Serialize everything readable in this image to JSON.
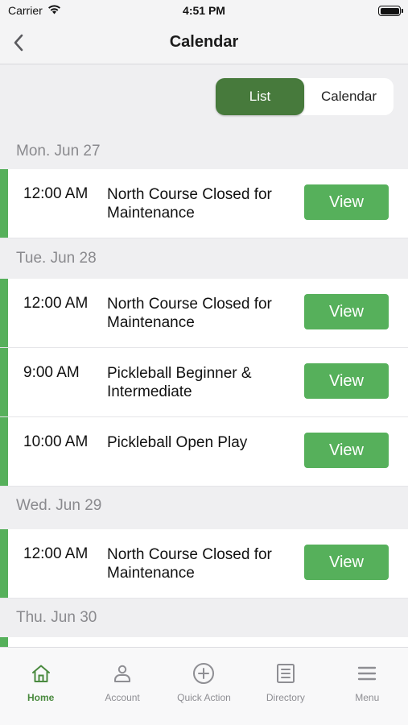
{
  "status_bar": {
    "carrier": "Carrier",
    "time": "4:51 PM"
  },
  "nav": {
    "title": "Calendar"
  },
  "segment": {
    "list_label": "List",
    "calendar_label": "Calendar",
    "selected": "List"
  },
  "days": [
    {
      "label": "Mon. Jun 27",
      "events": [
        {
          "time": "12:00 AM",
          "title": "North Course Closed for Maintenance",
          "button": "View"
        }
      ]
    },
    {
      "label": "Tue. Jun 28",
      "events": [
        {
          "time": "12:00 AM",
          "title": "North Course Closed for Maintenance",
          "button": "View"
        },
        {
          "time": "9:00 AM",
          "title": "Pickleball Beginner & Intermediate",
          "button": "View"
        },
        {
          "time": "10:00 AM",
          "title": "Pickleball Open Play",
          "button": "View"
        }
      ]
    },
    {
      "label": "Wed. Jun 29",
      "events": [
        {
          "time": "12:00 AM",
          "title": "North Course Closed for Maintenance",
          "button": "View"
        }
      ]
    },
    {
      "label": "Thu. Jun 30",
      "events": []
    }
  ],
  "tabs": [
    {
      "label": "Home",
      "icon": "home-icon",
      "active": true
    },
    {
      "label": "Account",
      "icon": "account-icon",
      "active": false
    },
    {
      "label": "Quick Action",
      "icon": "plus-circle-icon",
      "active": false
    },
    {
      "label": "Directory",
      "icon": "directory-icon",
      "active": false
    },
    {
      "label": "Menu",
      "icon": "menu-icon",
      "active": false
    }
  ],
  "colors": {
    "accent_green": "#56b05b",
    "segment_active": "#477a3c",
    "tab_active": "#4a8a3f"
  }
}
